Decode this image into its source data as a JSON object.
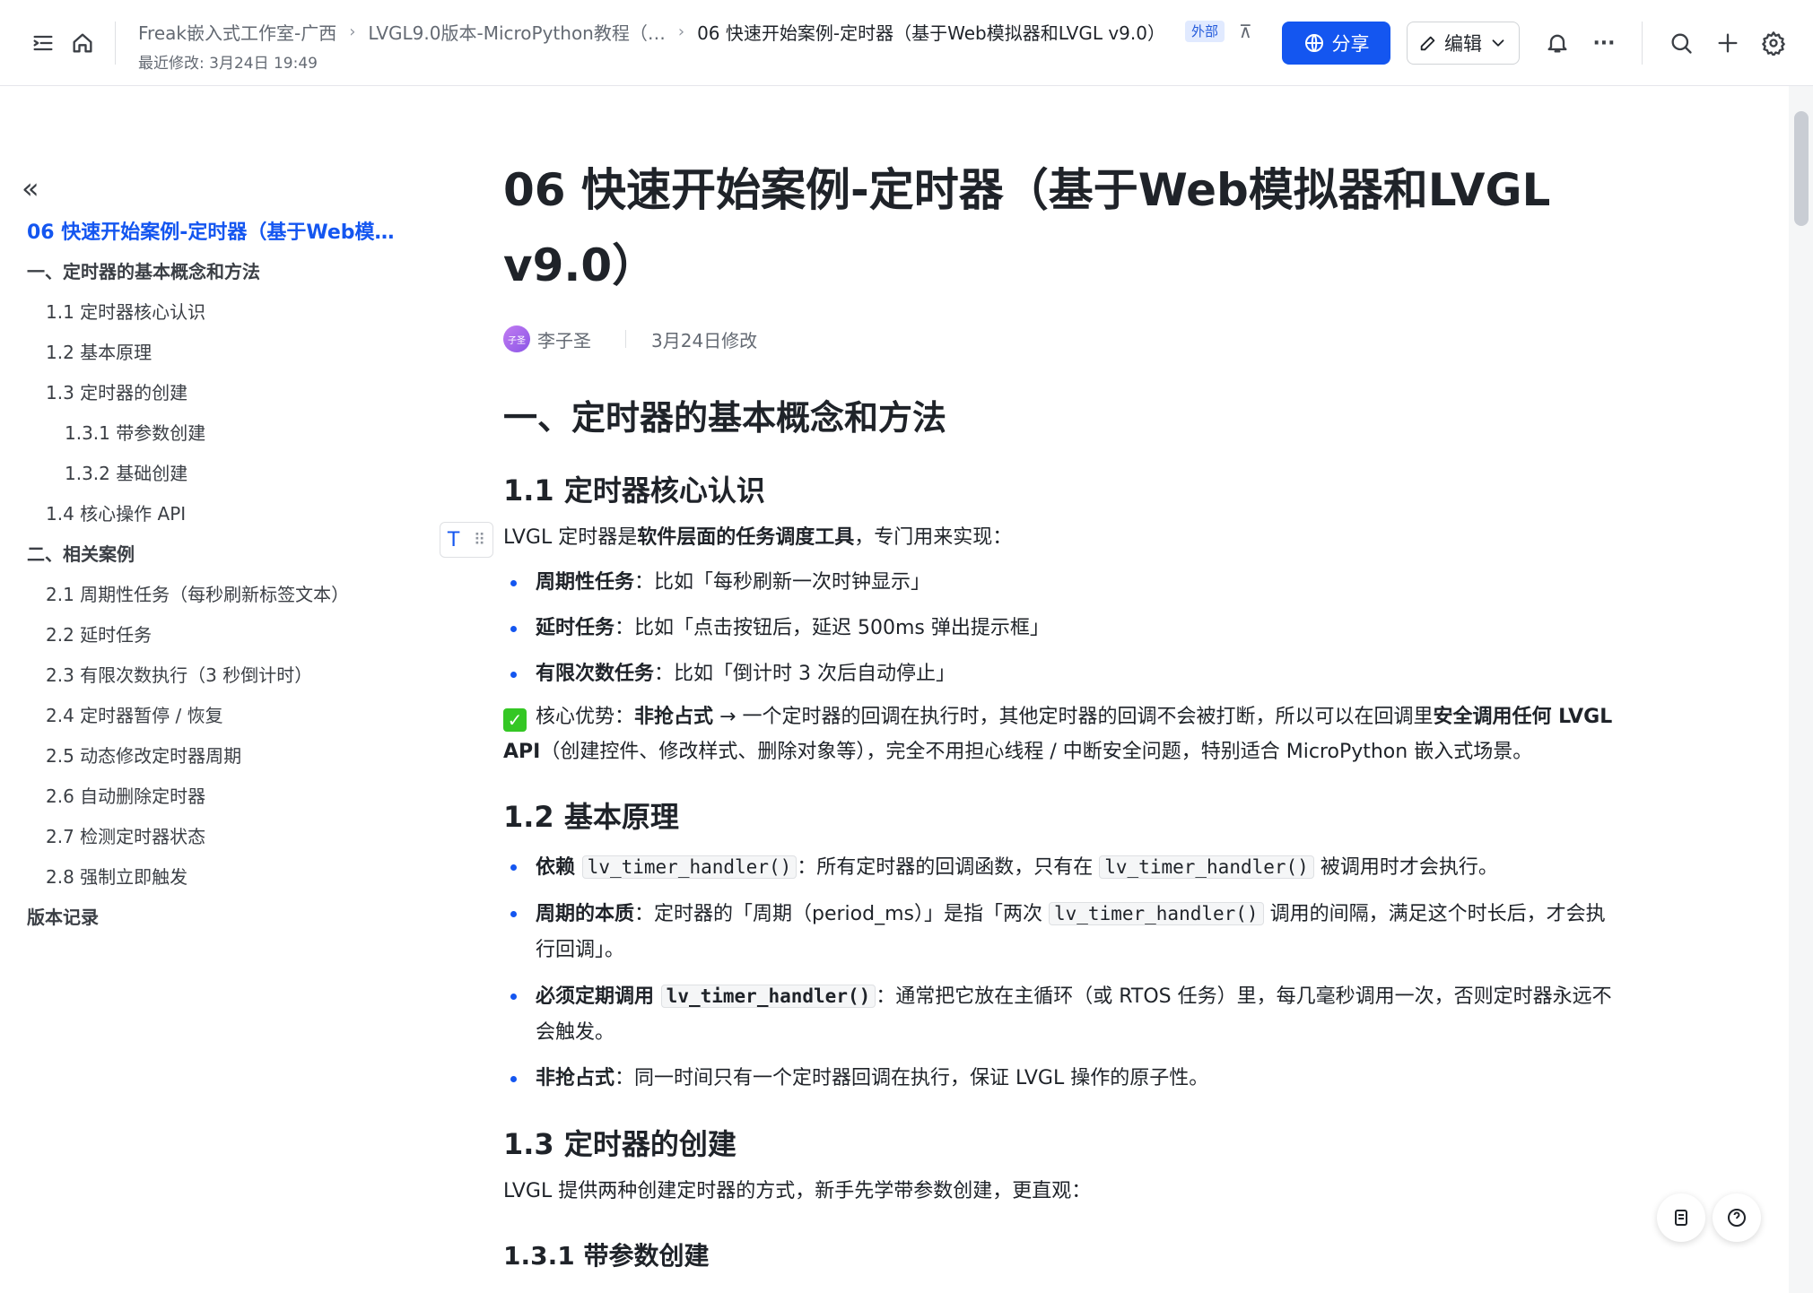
{
  "topbar": {
    "breadcrumbs": [
      "Freak嵌入式工作室-广西",
      "LVGL9.0版本-MicroPython教程（…",
      "06 快速开始案例-定时器（基于Web模拟器和LVGL v9.0）"
    ],
    "external_badge": "外部",
    "last_modified": "最近修改: 3月24日 19:49",
    "share_label": "分享",
    "edit_label": "编辑",
    "more_label": "···",
    "accent_color": "#1456f0"
  },
  "toc": {
    "items": [
      {
        "label": "06 快速开始案例-定时器（基于Web模…",
        "level": "active"
      },
      {
        "label": "一、定时器的基本概念和方法",
        "level": "l0"
      },
      {
        "label": "1.1 定时器核心认识",
        "level": "l1"
      },
      {
        "label": "1.2 基本原理",
        "level": "l1"
      },
      {
        "label": "1.3 定时器的创建",
        "level": "l1"
      },
      {
        "label": "1.3.1 带参数创建",
        "level": "l2"
      },
      {
        "label": "1.3.2 基础创建",
        "level": "l2"
      },
      {
        "label": "1.4 核心操作 API",
        "level": "l1"
      },
      {
        "label": "二、相关案例",
        "level": "l0"
      },
      {
        "label": "2.1 周期性任务（每秒刷新标签文本）",
        "level": "l1"
      },
      {
        "label": "2.2 延时任务",
        "level": "l1"
      },
      {
        "label": "2.3 有限次数执行（3 秒倒计时）",
        "level": "l1"
      },
      {
        "label": "2.4 定时器暂停 / 恢复",
        "level": "l1"
      },
      {
        "label": "2.5 动态修改定时器周期",
        "level": "l1"
      },
      {
        "label": "2.6 自动删除定时器",
        "level": "l1"
      },
      {
        "label": "2.7 检测定时器状态",
        "level": "l1"
      },
      {
        "label": "2.8 强制立即触发",
        "level": "l1"
      },
      {
        "label": "版本记录",
        "level": "l0"
      }
    ]
  },
  "doc": {
    "title": "06 快速开始案例-定时器（基于Web模拟器和LVGL v9.0）",
    "author_avatar": "子圣",
    "author": "李子圣",
    "modified": "3月24日修改",
    "h_section1": "一、定时器的基本概念和方法",
    "h_1_1": "1.1  定时器核心认识",
    "intro_pre": "LVGL 定时器是",
    "intro_bold": "软件层面的任务调度工具",
    "intro_post": "，专门用来实现：",
    "uses": [
      {
        "bold": "周期性任务",
        "text": "：比如「每秒刷新一次时钟显示」"
      },
      {
        "bold": "延时任务",
        "text": "：比如「点击按钮后，延迟 500ms 弹出提示框」"
      },
      {
        "bold": "有限次数任务",
        "text": "：比如「倒计时 3 次后自动停止」"
      }
    ],
    "adv_label": "核心优势：",
    "adv_bold1": "非抢占式",
    "adv_mid": " → 一个定时器的回调在执行时，其他定时器的回调不会被打断，所以可以在回调里",
    "adv_bold2": "安全调用任何 LVGL API",
    "adv_post": "（创建控件、修改样式、删除对象等），完全不用担心线程 / 中断安全问题，特别适合 MicroPython 嵌入式场景。",
    "h_1_2": "1.2 基本原理",
    "p1_bold": "依赖 ",
    "p1_code": "lv_timer_handler()",
    "p1_mid": "：所有定时器的回调函数，只有在 ",
    "p1_code2": "lv_timer_handler()",
    "p1_post": " 被调用时才会执行。",
    "p2_bold": "周期的本质",
    "p2_pre": "：定时器的「周期（period_ms）」是指「两次 ",
    "p2_code": "lv_timer_handler()",
    "p2_post": " 调用的间隔，满足这个时长后，才会执行回调」。",
    "p3_bold": "必须定期调用 ",
    "p3_code": "lv_timer_handler()",
    "p3_post": "：通常把它放在主循环（或 RTOS 任务）里，每几毫秒调用一次，否则定时器永远不会触发。",
    "p4_bold": "非抢占式",
    "p4_post": "：同一时间只有一个定时器回调在执行，保证 LVGL 操作的原子性。",
    "h_1_3": "1.3 定时器的创建",
    "create_intro": "LVGL 提供两种创建定时器的方式，新手先学带参数创建，更直观：",
    "h_1_3_1": "1.3.1 带参数创建"
  }
}
